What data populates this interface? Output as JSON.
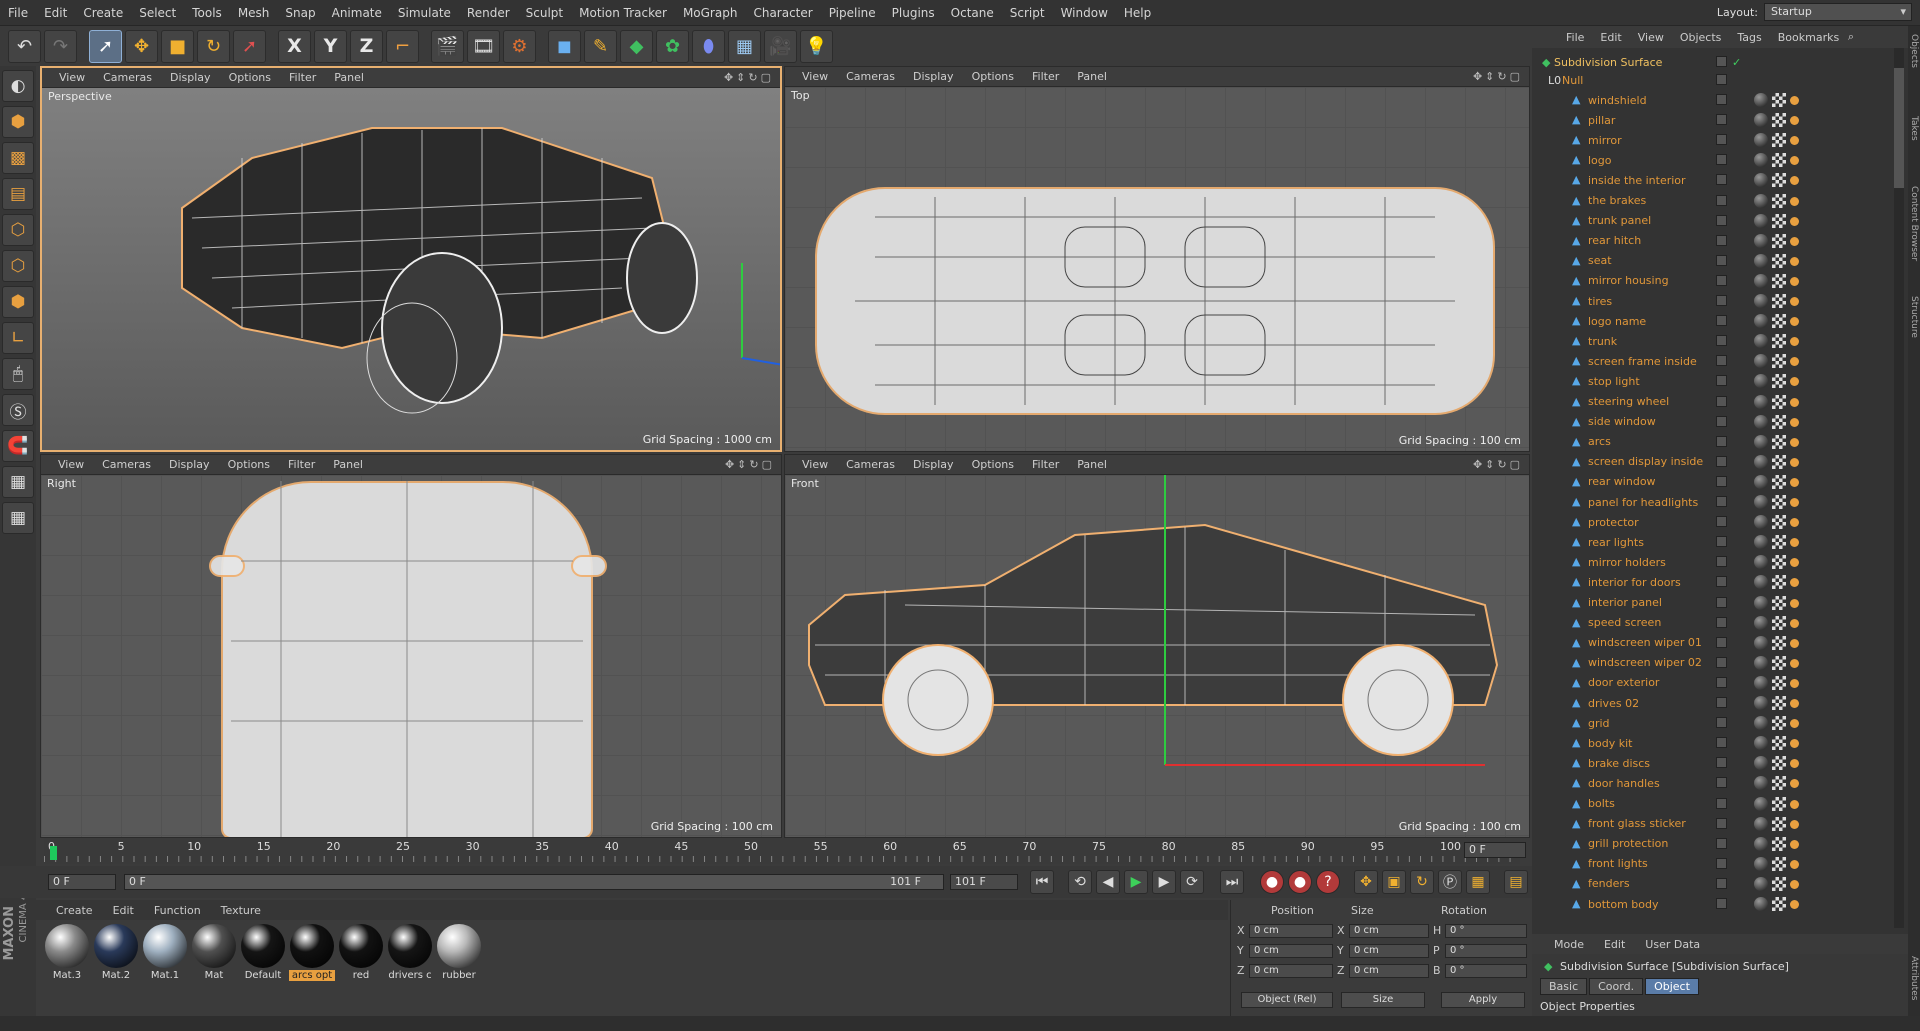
{
  "menubar": {
    "items": [
      "File",
      "Edit",
      "Create",
      "Select",
      "Tools",
      "Mesh",
      "Snap",
      "Animate",
      "Simulate",
      "Render",
      "Sculpt",
      "Motion Tracker",
      "MoGraph",
      "Character",
      "Pipeline",
      "Plugins",
      "Octane",
      "Script",
      "Window",
      "Help"
    ],
    "layout_label": "Layout:",
    "layout_value": "Startup"
  },
  "toolbar": {
    "icons": [
      "undo-icon",
      "redo-icon",
      "live-selection-icon",
      "move-icon",
      "scale-icon",
      "rotate-icon",
      "recent-tool-icon",
      "x-axis-icon",
      "y-axis-icon",
      "z-axis-icon",
      "coordinate-system-icon",
      "render-view-icon",
      "render-picture-viewer-icon",
      "edit-render-settings-icon",
      "cube-icon",
      "pen-icon",
      "subdivision-icon",
      "array-icon",
      "deformer-icon",
      "floor-icon",
      "camera-icon",
      "light-icon"
    ],
    "axis_x": "X",
    "axis_y": "Y",
    "axis_z": "Z"
  },
  "viewport_menu": [
    "View",
    "Cameras",
    "Display",
    "Options",
    "Filter",
    "Panel"
  ],
  "viewports": {
    "perspective": {
      "label": "Perspective",
      "grid": "Grid Spacing : 1000 cm"
    },
    "top": {
      "label": "Top",
      "grid": "Grid Spacing : 100 cm"
    },
    "right": {
      "label": "Right",
      "grid": "Grid Spacing : 100 cm"
    },
    "front": {
      "label": "Front",
      "grid": "Grid Spacing : 100 cm"
    }
  },
  "timeline": {
    "ticks": [
      "0",
      "5",
      "10",
      "15",
      "20",
      "25",
      "30",
      "35",
      "40",
      "45",
      "50",
      "55",
      "60",
      "65",
      "70",
      "75",
      "80",
      "85",
      "90",
      "95",
      "100"
    ],
    "end_frame": "0 F",
    "current": "0 F",
    "slider_start": "0 F",
    "slider_end": "101 F",
    "max": "101 F"
  },
  "materials": {
    "menu": [
      "Create",
      "Edit",
      "Function",
      "Texture"
    ],
    "items": [
      {
        "name": "Mat.3",
        "color": "#8a8a8a",
        "selected": false
      },
      {
        "name": "Mat.2",
        "color": "#2a3a5a",
        "selected": false
      },
      {
        "name": "Mat.1",
        "color": "#9fb0c0",
        "selected": false
      },
      {
        "name": "Mat",
        "color": "#505050",
        "selected": false
      },
      {
        "name": "Default",
        "color": "#151515",
        "selected": false
      },
      {
        "name": "arcs opt",
        "color": "#111111",
        "selected": true
      },
      {
        "name": "red",
        "color": "#121212",
        "selected": false
      },
      {
        "name": "drivers c",
        "color": "#151515",
        "selected": false
      },
      {
        "name": "rubber",
        "color": "#b8b8b8",
        "selected": false
      }
    ]
  },
  "coords": {
    "headers": [
      "Position",
      "Size",
      "Rotation"
    ],
    "rows": [
      {
        "axis": "X",
        "pos": "0 cm",
        "size_axis": "X",
        "size": "0 cm",
        "rot_axis": "H",
        "rot": "0 °"
      },
      {
        "axis": "Y",
        "pos": "0 cm",
        "size_axis": "Y",
        "size": "0 cm",
        "rot_axis": "P",
        "rot": "0 °"
      },
      {
        "axis": "Z",
        "pos": "0 cm",
        "size_axis": "Z",
        "size": "0 cm",
        "rot_axis": "B",
        "rot": "0 °"
      }
    ],
    "mode": "Object (Rel)",
    "size_mode": "Size",
    "apply": "Apply"
  },
  "objects": {
    "menu": [
      "File",
      "Edit",
      "View",
      "Objects",
      "Tags",
      "Bookmarks"
    ],
    "root": "Subdivision Surface",
    "null": "Null",
    "items": [
      "windshield",
      "pillar",
      "mirror",
      "logo",
      "inside the interior",
      "the brakes",
      "trunk panel",
      "rear hitch",
      "seat",
      "mirror housing",
      "tires",
      "logo name",
      "trunk",
      "screen frame inside",
      "stop light",
      "steering wheel",
      "side window",
      "arcs",
      "screen display inside",
      "rear window",
      "panel for headlights",
      "protector",
      "rear lights",
      "mirror holders",
      "interior for doors",
      "interior panel",
      "speed screen",
      "windscreen wiper 01",
      "windscreen wiper 02",
      "door exterior",
      "drives 02",
      "grid",
      "body kit",
      "brake discs",
      "door handles",
      "bolts",
      "front glass sticker",
      "grill protection",
      "front lights",
      "fenders",
      "bottom body"
    ]
  },
  "attributes": {
    "menu": [
      "Mode",
      "Edit",
      "User Data"
    ],
    "title": "Subdivision Surface [Subdivision Surface]",
    "tabs": [
      "Basic",
      "Coord.",
      "Object"
    ],
    "active_tab": "Object",
    "section": "Object Properties"
  },
  "side_tabs": [
    "Objects",
    "Takes",
    "Content Browser",
    "Structure",
    "Attributes"
  ],
  "logo": {
    "brand": "MAXON",
    "product": "CINEMA 4D"
  }
}
